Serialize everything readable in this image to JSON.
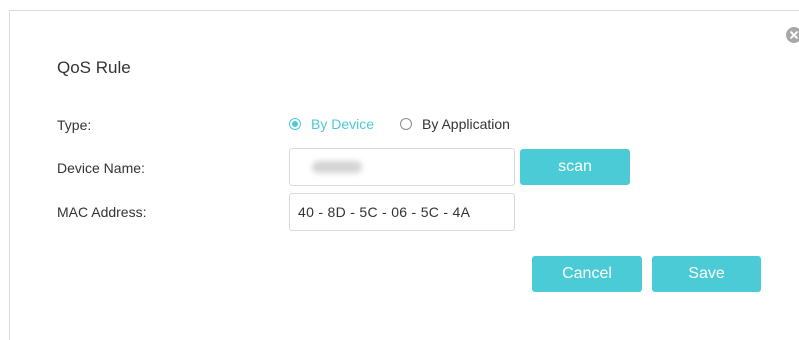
{
  "dialog": {
    "title": "QoS Rule",
    "close_icon": "close-icon"
  },
  "form": {
    "type": {
      "label": "Type:",
      "options": [
        {
          "label": "By Device",
          "selected": true
        },
        {
          "label": "By Application",
          "selected": false
        }
      ]
    },
    "device_name": {
      "label": "Device Name:",
      "value_obscured": true
    },
    "scan_label": "scan",
    "mac_address": {
      "label": "MAC Address:",
      "value": "40 - 8D - 5C - 06 - 5C - 4A"
    }
  },
  "actions": {
    "cancel_label": "Cancel",
    "save_label": "Save"
  },
  "colors": {
    "accent": "#4acbd6",
    "text": "#333333",
    "border": "#d9d9d9"
  }
}
